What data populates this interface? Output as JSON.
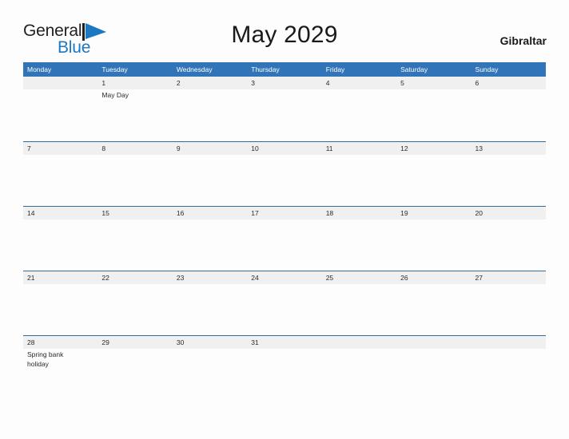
{
  "brand": {
    "word_one": "General",
    "word_two": "Blue",
    "flag_icon": "flag-triangle-icon",
    "dark_color": "#231f20",
    "blue_color": "#1b78c2"
  },
  "header": {
    "title": "May 2029",
    "region": "Gibraltar"
  },
  "theme": {
    "header_blue": "#3175b8",
    "rule_blue": "#2e6da4",
    "date_band_gray": "#f0f0f0",
    "page_background": "#fdfdfd"
  },
  "calendar": {
    "weekdays": [
      "Monday",
      "Tuesday",
      "Wednesday",
      "Thursday",
      "Friday",
      "Saturday",
      "Sunday"
    ],
    "weeks": [
      [
        {
          "day": "",
          "event": ""
        },
        {
          "day": "1",
          "event": "May Day"
        },
        {
          "day": "2",
          "event": ""
        },
        {
          "day": "3",
          "event": ""
        },
        {
          "day": "4",
          "event": ""
        },
        {
          "day": "5",
          "event": ""
        },
        {
          "day": "6",
          "event": ""
        }
      ],
      [
        {
          "day": "7",
          "event": ""
        },
        {
          "day": "8",
          "event": ""
        },
        {
          "day": "9",
          "event": ""
        },
        {
          "day": "10",
          "event": ""
        },
        {
          "day": "11",
          "event": ""
        },
        {
          "day": "12",
          "event": ""
        },
        {
          "day": "13",
          "event": ""
        }
      ],
      [
        {
          "day": "14",
          "event": ""
        },
        {
          "day": "15",
          "event": ""
        },
        {
          "day": "16",
          "event": ""
        },
        {
          "day": "17",
          "event": ""
        },
        {
          "day": "18",
          "event": ""
        },
        {
          "day": "19",
          "event": ""
        },
        {
          "day": "20",
          "event": ""
        }
      ],
      [
        {
          "day": "21",
          "event": ""
        },
        {
          "day": "22",
          "event": ""
        },
        {
          "day": "23",
          "event": ""
        },
        {
          "day": "24",
          "event": ""
        },
        {
          "day": "25",
          "event": ""
        },
        {
          "day": "26",
          "event": ""
        },
        {
          "day": "27",
          "event": ""
        }
      ],
      [
        {
          "day": "28",
          "event": "Spring bank holiday"
        },
        {
          "day": "29",
          "event": ""
        },
        {
          "day": "30",
          "event": ""
        },
        {
          "day": "31",
          "event": ""
        },
        {
          "day": "",
          "event": ""
        },
        {
          "day": "",
          "event": ""
        },
        {
          "day": "",
          "event": ""
        }
      ]
    ]
  }
}
